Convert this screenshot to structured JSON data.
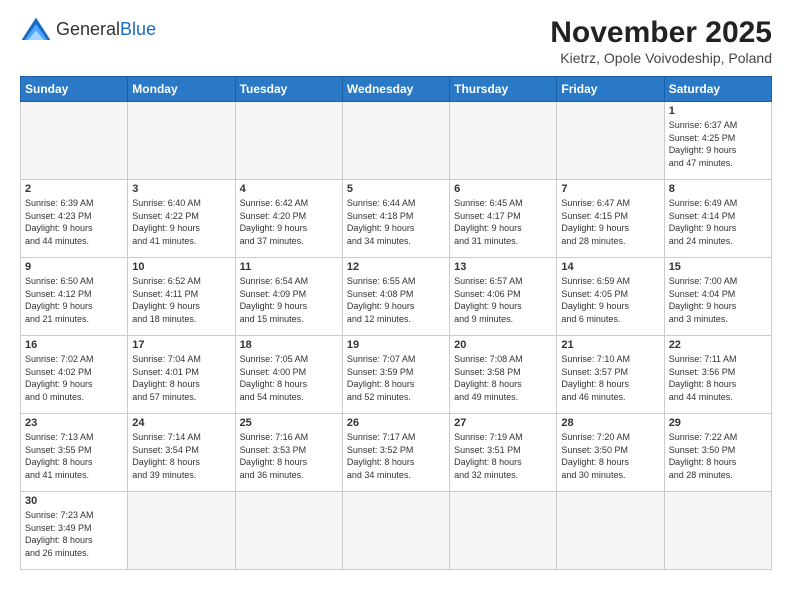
{
  "header": {
    "logo_general": "General",
    "logo_blue": "Blue",
    "month_title": "November 2025",
    "location": "Kietrz, Opole Voivodeship, Poland"
  },
  "days_of_week": [
    "Sunday",
    "Monday",
    "Tuesday",
    "Wednesday",
    "Thursday",
    "Friday",
    "Saturday"
  ],
  "weeks": [
    [
      {
        "day": "",
        "info": ""
      },
      {
        "day": "",
        "info": ""
      },
      {
        "day": "",
        "info": ""
      },
      {
        "day": "",
        "info": ""
      },
      {
        "day": "",
        "info": ""
      },
      {
        "day": "",
        "info": ""
      },
      {
        "day": "1",
        "info": "Sunrise: 6:37 AM\nSunset: 4:25 PM\nDaylight: 9 hours\nand 47 minutes."
      }
    ],
    [
      {
        "day": "2",
        "info": "Sunrise: 6:39 AM\nSunset: 4:23 PM\nDaylight: 9 hours\nand 44 minutes."
      },
      {
        "day": "3",
        "info": "Sunrise: 6:40 AM\nSunset: 4:22 PM\nDaylight: 9 hours\nand 41 minutes."
      },
      {
        "day": "4",
        "info": "Sunrise: 6:42 AM\nSunset: 4:20 PM\nDaylight: 9 hours\nand 37 minutes."
      },
      {
        "day": "5",
        "info": "Sunrise: 6:44 AM\nSunset: 4:18 PM\nDaylight: 9 hours\nand 34 minutes."
      },
      {
        "day": "6",
        "info": "Sunrise: 6:45 AM\nSunset: 4:17 PM\nDaylight: 9 hours\nand 31 minutes."
      },
      {
        "day": "7",
        "info": "Sunrise: 6:47 AM\nSunset: 4:15 PM\nDaylight: 9 hours\nand 28 minutes."
      },
      {
        "day": "8",
        "info": "Sunrise: 6:49 AM\nSunset: 4:14 PM\nDaylight: 9 hours\nand 24 minutes."
      }
    ],
    [
      {
        "day": "9",
        "info": "Sunrise: 6:50 AM\nSunset: 4:12 PM\nDaylight: 9 hours\nand 21 minutes."
      },
      {
        "day": "10",
        "info": "Sunrise: 6:52 AM\nSunset: 4:11 PM\nDaylight: 9 hours\nand 18 minutes."
      },
      {
        "day": "11",
        "info": "Sunrise: 6:54 AM\nSunset: 4:09 PM\nDaylight: 9 hours\nand 15 minutes."
      },
      {
        "day": "12",
        "info": "Sunrise: 6:55 AM\nSunset: 4:08 PM\nDaylight: 9 hours\nand 12 minutes."
      },
      {
        "day": "13",
        "info": "Sunrise: 6:57 AM\nSunset: 4:06 PM\nDaylight: 9 hours\nand 9 minutes."
      },
      {
        "day": "14",
        "info": "Sunrise: 6:59 AM\nSunset: 4:05 PM\nDaylight: 9 hours\nand 6 minutes."
      },
      {
        "day": "15",
        "info": "Sunrise: 7:00 AM\nSunset: 4:04 PM\nDaylight: 9 hours\nand 3 minutes."
      }
    ],
    [
      {
        "day": "16",
        "info": "Sunrise: 7:02 AM\nSunset: 4:02 PM\nDaylight: 9 hours\nand 0 minutes."
      },
      {
        "day": "17",
        "info": "Sunrise: 7:04 AM\nSunset: 4:01 PM\nDaylight: 8 hours\nand 57 minutes."
      },
      {
        "day": "18",
        "info": "Sunrise: 7:05 AM\nSunset: 4:00 PM\nDaylight: 8 hours\nand 54 minutes."
      },
      {
        "day": "19",
        "info": "Sunrise: 7:07 AM\nSunset: 3:59 PM\nDaylight: 8 hours\nand 52 minutes."
      },
      {
        "day": "20",
        "info": "Sunrise: 7:08 AM\nSunset: 3:58 PM\nDaylight: 8 hours\nand 49 minutes."
      },
      {
        "day": "21",
        "info": "Sunrise: 7:10 AM\nSunset: 3:57 PM\nDaylight: 8 hours\nand 46 minutes."
      },
      {
        "day": "22",
        "info": "Sunrise: 7:11 AM\nSunset: 3:56 PM\nDaylight: 8 hours\nand 44 minutes."
      }
    ],
    [
      {
        "day": "23",
        "info": "Sunrise: 7:13 AM\nSunset: 3:55 PM\nDaylight: 8 hours\nand 41 minutes."
      },
      {
        "day": "24",
        "info": "Sunrise: 7:14 AM\nSunset: 3:54 PM\nDaylight: 8 hours\nand 39 minutes."
      },
      {
        "day": "25",
        "info": "Sunrise: 7:16 AM\nSunset: 3:53 PM\nDaylight: 8 hours\nand 36 minutes."
      },
      {
        "day": "26",
        "info": "Sunrise: 7:17 AM\nSunset: 3:52 PM\nDaylight: 8 hours\nand 34 minutes."
      },
      {
        "day": "27",
        "info": "Sunrise: 7:19 AM\nSunset: 3:51 PM\nDaylight: 8 hours\nand 32 minutes."
      },
      {
        "day": "28",
        "info": "Sunrise: 7:20 AM\nSunset: 3:50 PM\nDaylight: 8 hours\nand 30 minutes."
      },
      {
        "day": "29",
        "info": "Sunrise: 7:22 AM\nSunset: 3:50 PM\nDaylight: 8 hours\nand 28 minutes."
      }
    ],
    [
      {
        "day": "30",
        "info": "Sunrise: 7:23 AM\nSunset: 3:49 PM\nDaylight: 8 hours\nand 26 minutes."
      },
      {
        "day": "",
        "info": ""
      },
      {
        "day": "",
        "info": ""
      },
      {
        "day": "",
        "info": ""
      },
      {
        "day": "",
        "info": ""
      },
      {
        "day": "",
        "info": ""
      },
      {
        "day": "",
        "info": ""
      }
    ]
  ]
}
